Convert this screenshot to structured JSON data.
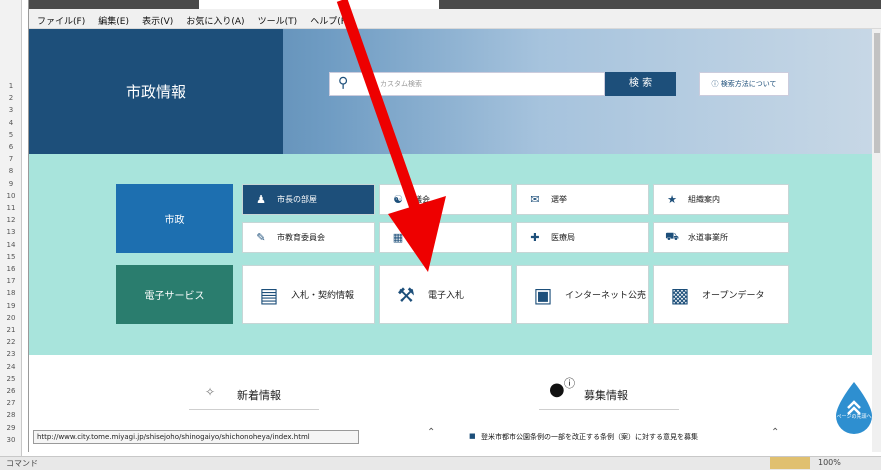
{
  "browser": {
    "menu": [
      "ファイル(F)",
      "編集(E)",
      "表示(V)",
      "お気に入り(A)",
      "ツール(T)",
      "ヘルプ(H)"
    ],
    "status_url": "http://www.city.tome.miyagi.jp/shisejoho/shinogaiyo/shichonoheya/index.html"
  },
  "header": {
    "title": "市政情報",
    "search_placeholder": "カスタム検索",
    "search_button": "検 索",
    "search_help": "検索方法について"
  },
  "nav": {
    "category_city": "市政",
    "category_eservice": "電子サービス",
    "tiles_row1": [
      "市長の部屋",
      "議会",
      "選挙",
      "組織案内"
    ],
    "tiles_row2": [
      "市教育委員会",
      "部",
      "医療局",
      "水道事業所"
    ],
    "tiles_row3": [
      "入札・契約情報",
      "電子入札",
      "インターネット公売",
      "オープンデータ"
    ]
  },
  "news": {
    "new_title": "新着情報",
    "recruit_title": "募集情報",
    "recruit_item": "登米市都市公園条例の一部を改正する条例（案）に対する意見を募集"
  },
  "page_top": "ページの先頭へ",
  "excel": {
    "status_left": "コマンド",
    "zoom": "100%"
  },
  "annotation": {
    "arrow_color": "#ee0000"
  }
}
